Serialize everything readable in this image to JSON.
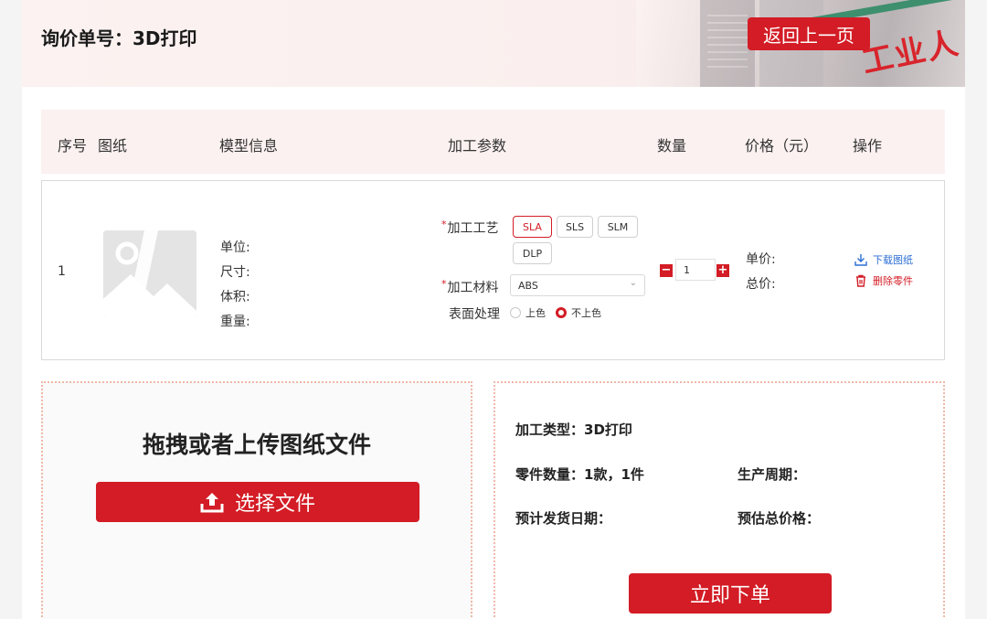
{
  "header": {
    "title": "询价单号：3D打印",
    "back_label": "返回上一页",
    "banner_sign_text": "工业人"
  },
  "table": {
    "columns": [
      "序号",
      "图纸",
      "模型信息",
      "加工参数",
      "数量",
      "价格（元）",
      "操作"
    ],
    "row": {
      "index": "1",
      "model_info": [
        "单位:",
        "尺寸:",
        "体积:",
        "重量:"
      ],
      "process_label": "加工工艺",
      "process_options": [
        "SLA",
        "SLS",
        "SLM",
        "DLP"
      ],
      "process_selected": "SLA",
      "material_label": "加工材料",
      "material_value": "ABS",
      "surface_label": "表面处理",
      "surface_options": [
        "上色",
        "不上色"
      ],
      "surface_selected": "不上色",
      "quantity": "1",
      "qty_minus": "−",
      "qty_plus": "+",
      "unit_price_label": "单价:",
      "total_price_label": "总价:",
      "download_label": "下载图纸",
      "delete_label": "删除零件",
      "required_mark": "*"
    }
  },
  "upload": {
    "title": "拖拽或者上传图纸文件",
    "button_label": "选择文件"
  },
  "summary": {
    "process_type": "加工类型：3D打印",
    "part_count": "零件数量：1款，1件",
    "production_cycle": "生产周期：",
    "ship_date": "预计发货日期：",
    "estimated_total": "预估总价格：",
    "order_button": "立即下单"
  },
  "colors": {
    "accent": "#d31c25",
    "link_blue": "#2c6ed3",
    "header_bg": "#fbf1f0"
  }
}
